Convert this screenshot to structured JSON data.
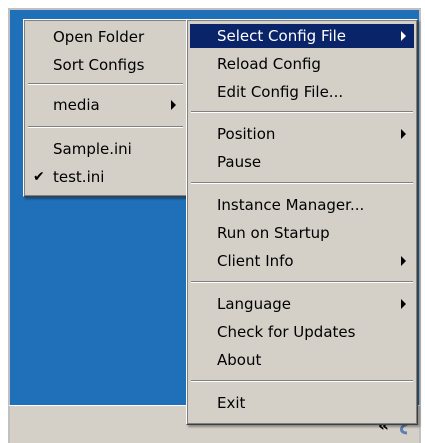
{
  "submenu": {
    "items": [
      {
        "label": "Open Folder"
      },
      {
        "label": "Sort Configs"
      },
      {
        "label": "media"
      },
      {
        "label": "Sample.ini"
      },
      {
        "label": "test.ini",
        "checked": true
      }
    ]
  },
  "mainmenu": {
    "items": [
      {
        "label": "Select Config File",
        "highlighted": true
      },
      {
        "label": "Reload Config"
      },
      {
        "label": "Edit Config File..."
      },
      {
        "label": "Position"
      },
      {
        "label": "Pause"
      },
      {
        "label": "Instance Manager..."
      },
      {
        "label": "Run on Startup"
      },
      {
        "label": "Client Info"
      },
      {
        "label": "Language"
      },
      {
        "label": "Check for Updates"
      },
      {
        "label": "About"
      },
      {
        "label": "Exit"
      }
    ]
  },
  "taskbar": {
    "chevron": "«"
  },
  "colors": {
    "desktop": "#1f70b8",
    "menu_face": "#d4d0c8",
    "highlight": "#0a246a"
  },
  "icons": {
    "check": "check-icon",
    "submenu_arrow": "submenu-arrow-icon",
    "tray": "tray-app-icon"
  }
}
